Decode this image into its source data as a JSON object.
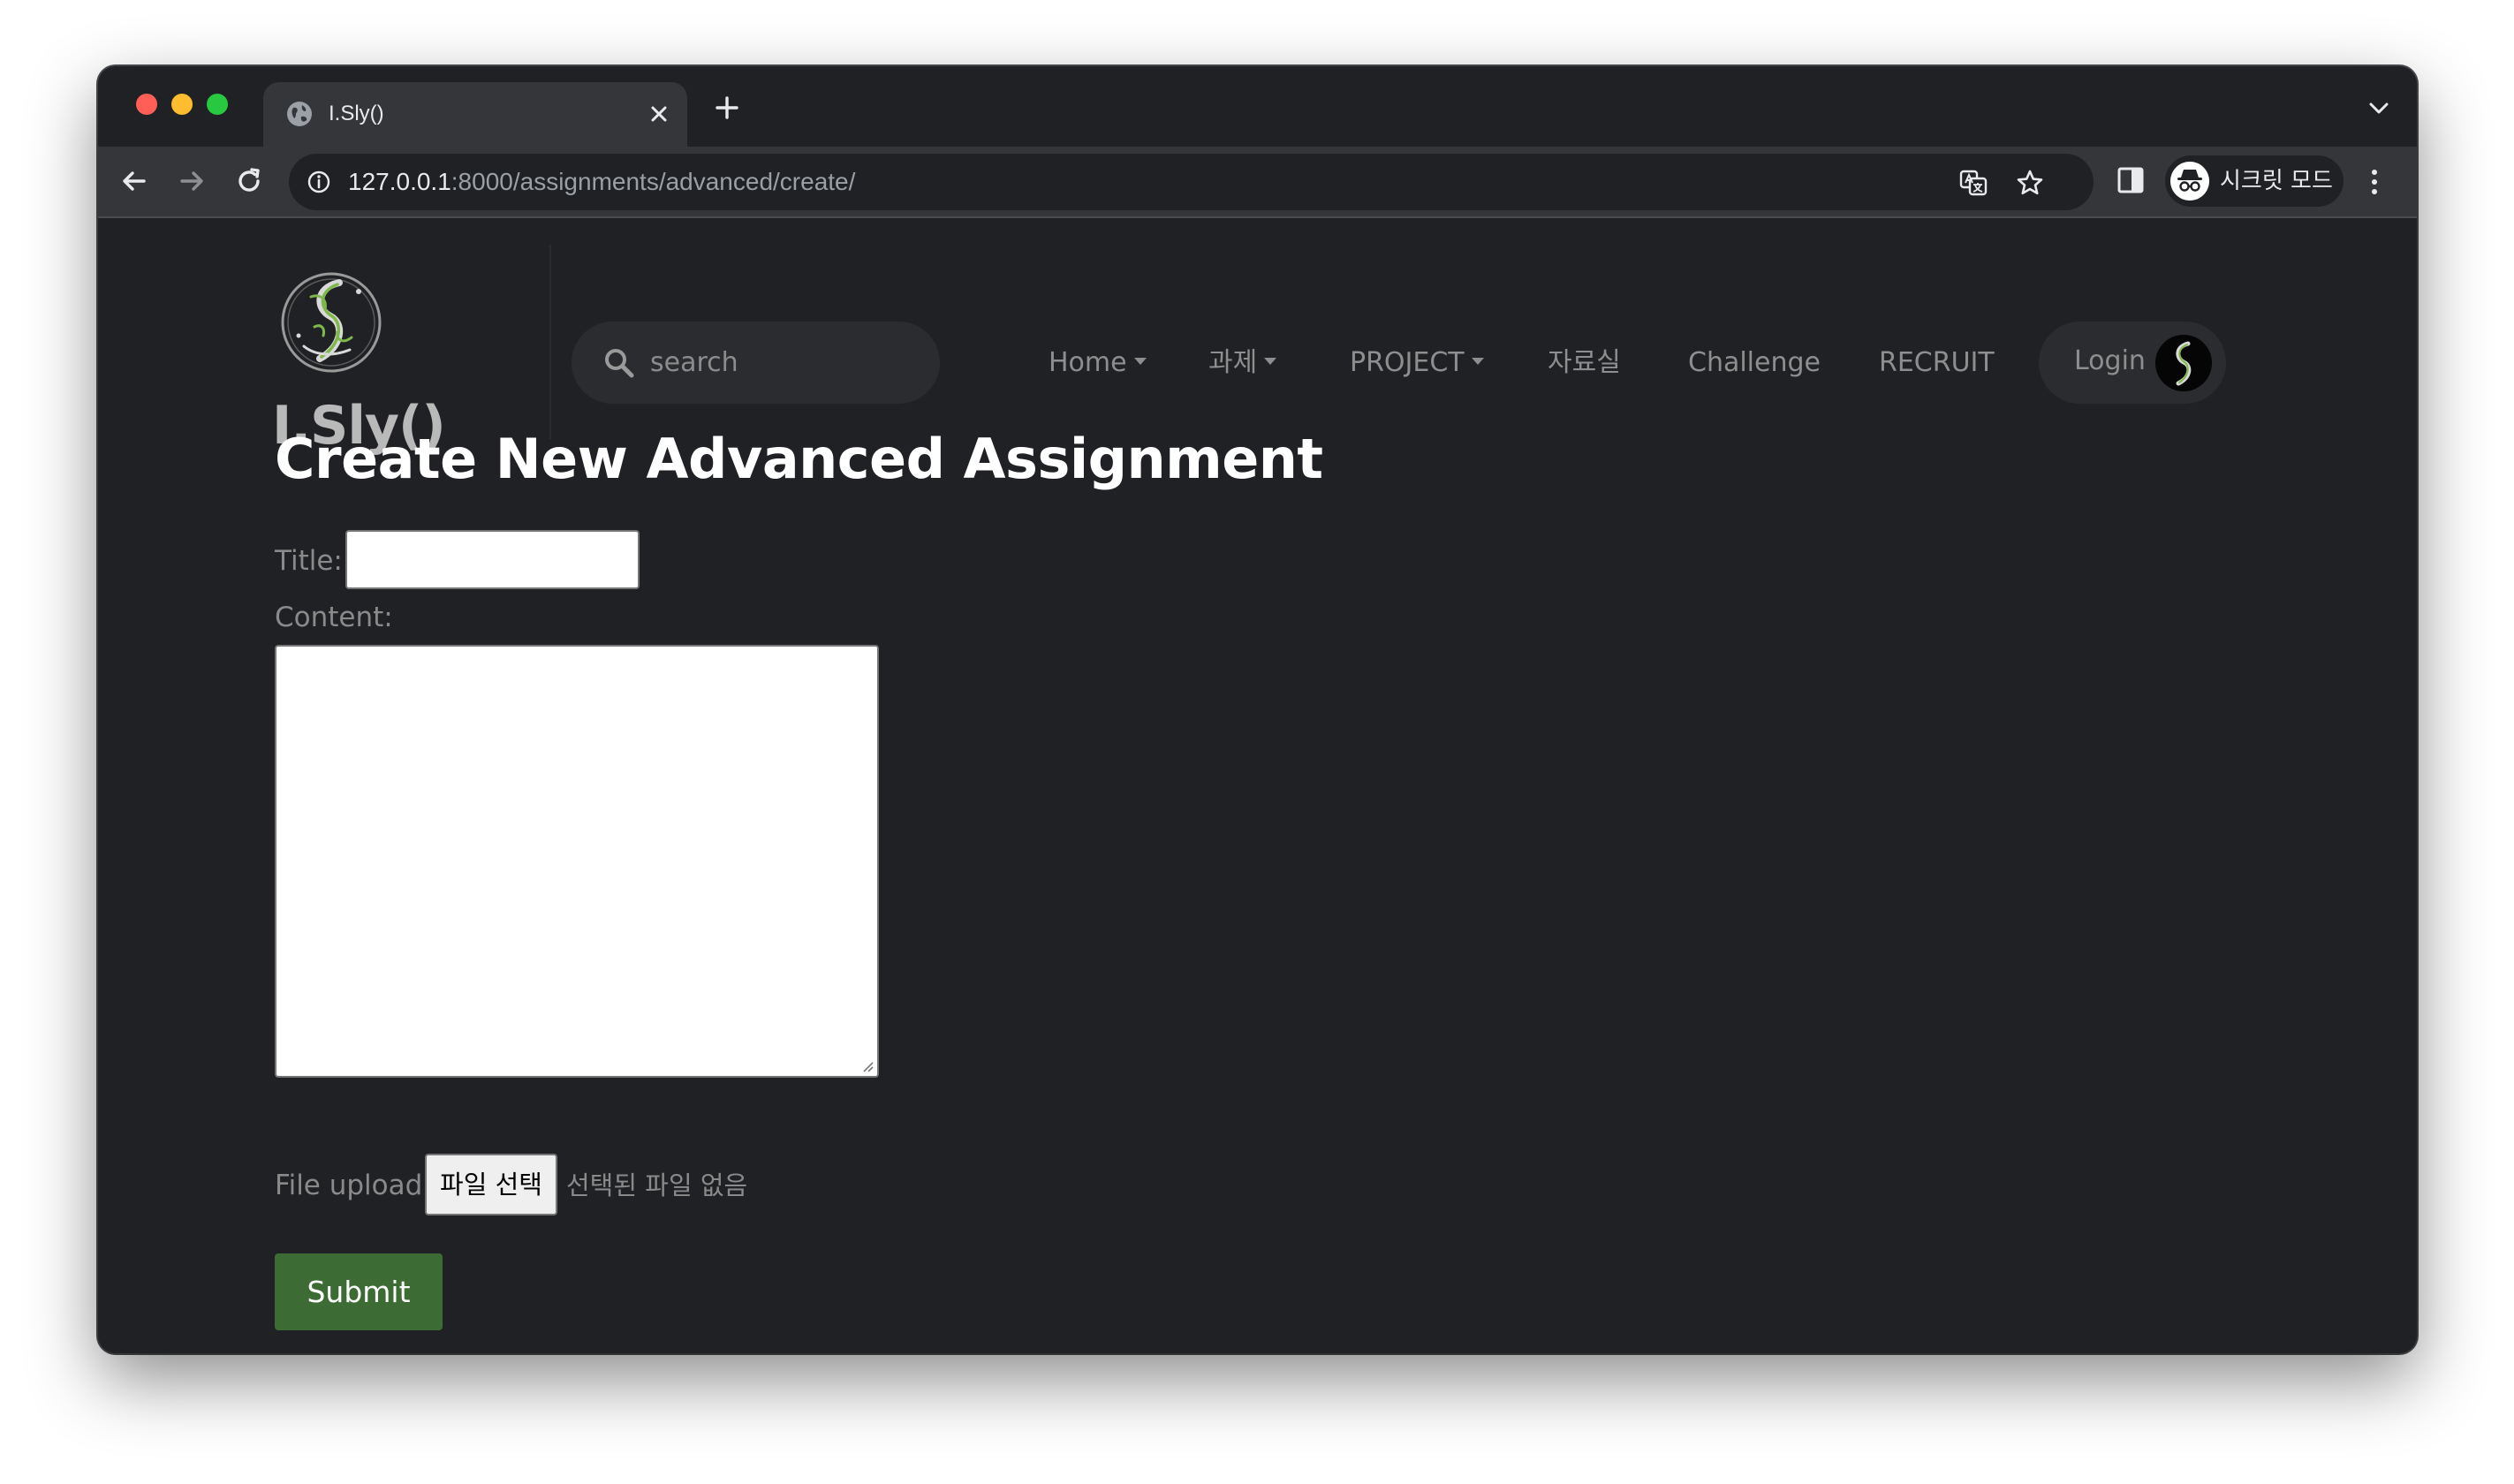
{
  "browser": {
    "tab_title": "I.Sly()",
    "url_host": "127.0.0.1",
    "url_path": ":8000/assignments/advanced/create/",
    "profile_label": "시크릿 모드"
  },
  "site": {
    "brand": "I.Sly()",
    "search_placeholder": "search",
    "nav": {
      "home": "Home",
      "assignments": "과제",
      "project": "PROJECT",
      "library": "자료실",
      "challenge": "Challenge",
      "recruit": "RECRUIT",
      "login": "Login"
    }
  },
  "form": {
    "heading": "Create New Advanced Assignment",
    "title_label": "Title:",
    "title_value": "",
    "content_label": "Content:",
    "content_value": "",
    "file_label": "File upload:",
    "file_button": "파일 선택",
    "file_status": "선택된 파일 없음",
    "submit_label": "Submit"
  },
  "colors": {
    "page_bg": "#202124",
    "submit_bg": "#3d6b34",
    "accent_green": "#7fb84a"
  },
  "icons": [
    "globe-icon",
    "close-icon",
    "plus-icon",
    "chevron-down-icon",
    "back-arrow-icon",
    "forward-arrow-icon",
    "reload-icon",
    "info-icon",
    "translate-icon",
    "star-icon",
    "side-panel-icon",
    "incognito-icon",
    "more-vert-icon",
    "search-icon",
    "logo-icon"
  ]
}
